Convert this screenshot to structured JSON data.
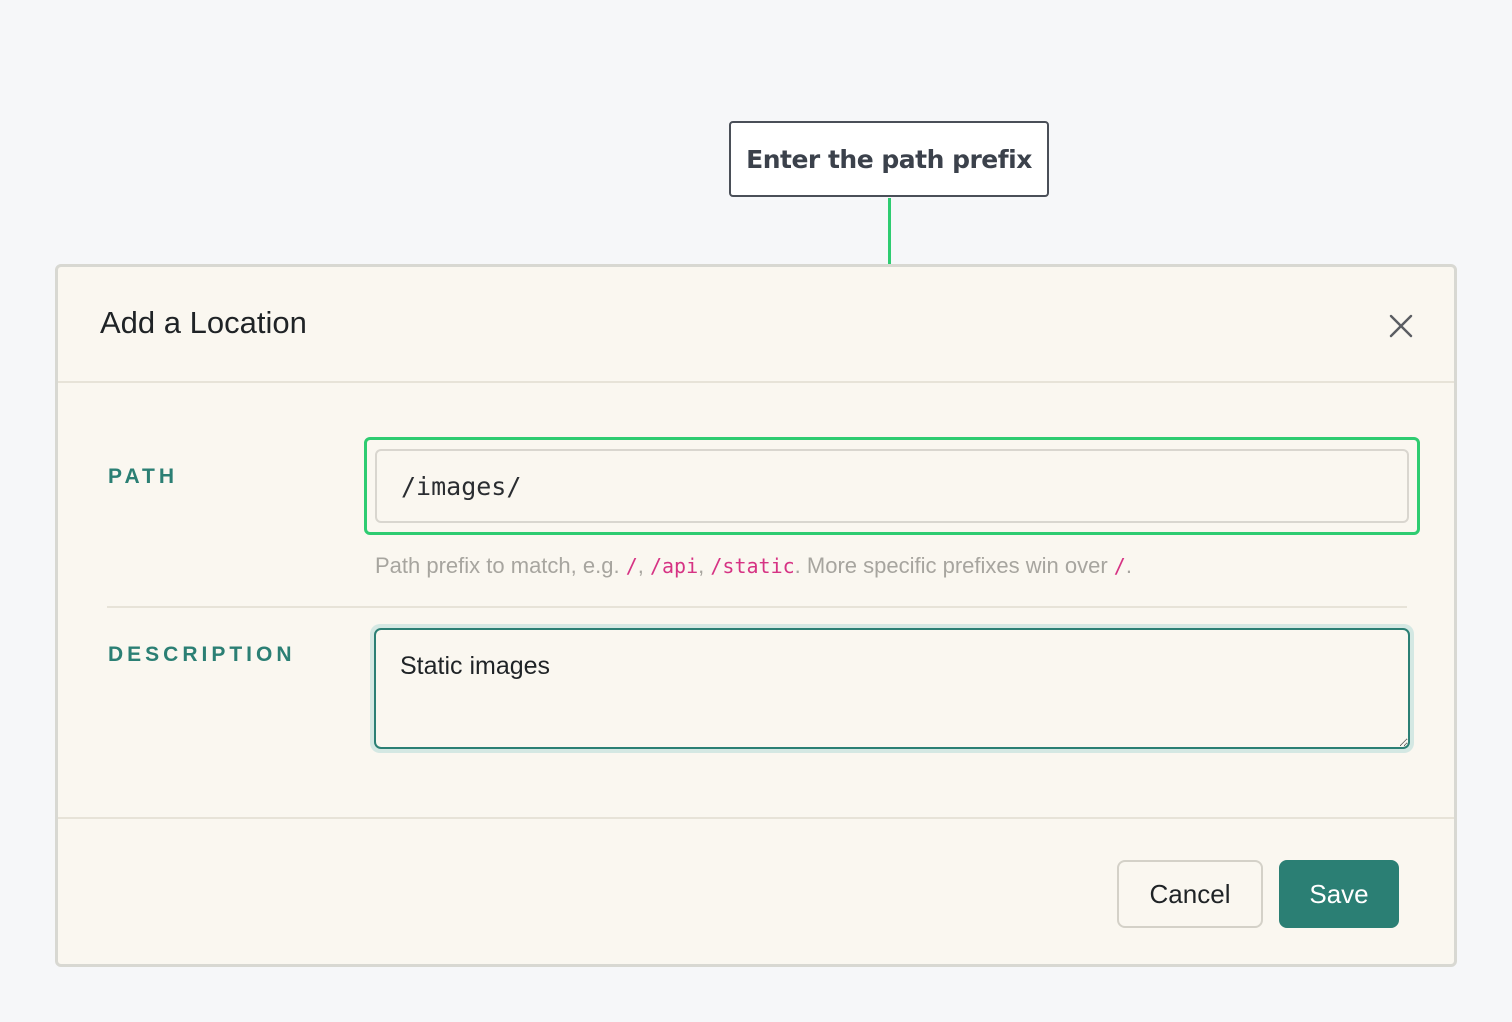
{
  "callout": {
    "text": "Enter the path prefix",
    "color": "#2ecc71"
  },
  "modal": {
    "title": "Add a Location",
    "close_icon": "close-icon"
  },
  "fields": {
    "path": {
      "label": "PATH",
      "value": "/images/",
      "hint": {
        "prefix": "Path prefix to match, e.g. ",
        "code1": "/",
        "sep1": ", ",
        "code2": "/api",
        "sep2": ", ",
        "code3": "/static",
        "middle": ". More specific prefixes win over ",
        "code4": "/",
        "suffix": "."
      }
    },
    "description": {
      "label": "DESCRIPTION",
      "value": "Static images"
    }
  },
  "footer": {
    "cancel_label": "Cancel",
    "save_label": "Save"
  },
  "colors": {
    "accent": "#2b7f74",
    "highlight": "#2ecc71",
    "code": "#d63384"
  }
}
